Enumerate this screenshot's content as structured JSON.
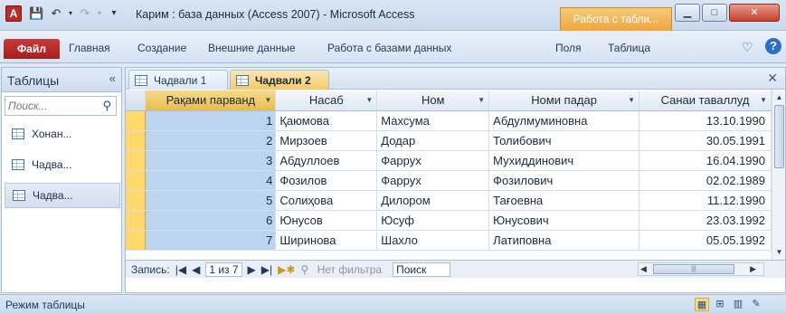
{
  "window": {
    "title": "Карим : база данных (Access 2007)  -  Microsoft Access",
    "context_tab": "Работа с табли...",
    "app_icon": "A"
  },
  "ribbon": {
    "file_tab": "Файл",
    "tabs": [
      "Главная",
      "Создание",
      "Внешние данные",
      "Работа с базами данных",
      "Поля",
      "Таблица"
    ]
  },
  "nav": {
    "header": "Таблицы",
    "search_placeholder": "Поиск...",
    "items": [
      {
        "label": "Хонан..."
      },
      {
        "label": "Чадва..."
      },
      {
        "label": "Чадва..."
      }
    ]
  },
  "doc_tabs": [
    {
      "label": "Чадвали 1"
    },
    {
      "label": "Чадвали 2"
    }
  ],
  "table": {
    "columns": [
      "Рақами парванд",
      "Насаб",
      "Ном",
      "Номи падар",
      "Санаи таваллуд"
    ],
    "rows": [
      [
        "1",
        "Қаюмова",
        "Махсума",
        "Абдулмуминовна",
        "13.10.1990"
      ],
      [
        "2",
        "Мирзоев",
        "Додар",
        "Толибович",
        "30.05.1991"
      ],
      [
        "3",
        "Абдуллоев",
        "Фаррух",
        "Мухиддинович",
        "16.04.1990"
      ],
      [
        "4",
        "Фозилов",
        "Фаррух",
        "Фозилович",
        "02.02.1989"
      ],
      [
        "5",
        "Солиҳова",
        "Дилором",
        "Тағоевна",
        "11.12.1990"
      ],
      [
        "6",
        "Юнусов",
        "Юсуф",
        "Юнусович",
        "23.03.1992"
      ],
      [
        "7",
        "Ширинова",
        "Шахло",
        "Латиповна",
        "05.05.1992"
      ]
    ]
  },
  "record_nav": {
    "label": "Запись:",
    "position": "1 из 7",
    "filter": "Нет фильтра",
    "search": "Поиск"
  },
  "status": {
    "mode": "Режим таблицы"
  },
  "colors": {
    "accent": "#b62d2d",
    "active_tab": "#f6c964",
    "selected_column": "#bcd4f0",
    "row_selector": "#ffd96b"
  }
}
